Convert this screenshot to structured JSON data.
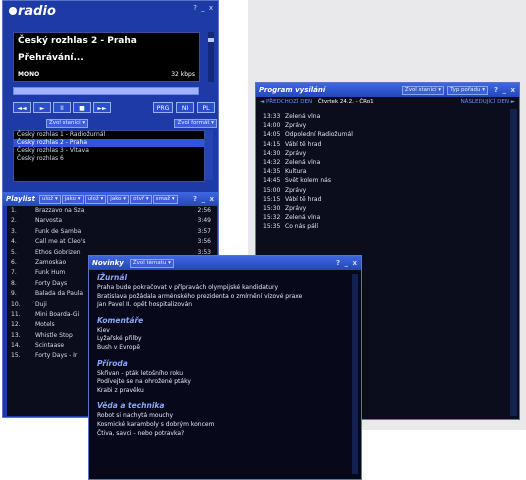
{
  "radio": {
    "logo": "radio",
    "controls": "? _ x",
    "station": "Český rozhlas 2 - Praha",
    "status": "Přehrávání...",
    "mode": "MONO",
    "bitrate": "32 kbps",
    "volume_progress": 1.0,
    "transport_buttons": [
      "◄◄",
      "►",
      "II",
      "■",
      "►►"
    ],
    "mode_buttons": [
      "PRG",
      "NI",
      "PL"
    ],
    "combo_stations": "Zvol stanici",
    "combo_format": "Zvol formát",
    "stations": [
      "Český rozhlas 1 - Radiožurnál",
      "Český rozhlas 2 - Praha",
      "Český rozhlas 3 - Vltava",
      "Český rozhlas 6"
    ],
    "selected_station_index": 1
  },
  "playlist": {
    "title": "Playlist",
    "actions": [
      "ulož",
      "jako",
      "ulož",
      "jako",
      "otvř",
      "smaž"
    ],
    "controls": "? _ x",
    "items": [
      {
        "n": "1.",
        "title": "Brazzavo na Sza",
        "dur": "2:56"
      },
      {
        "n": "2.",
        "title": "Narvosta",
        "dur": "3:49"
      },
      {
        "n": "3.",
        "title": "Funk de Samba",
        "dur": "3:57"
      },
      {
        "n": "4.",
        "title": "Call me at Cleo's",
        "dur": "3:56"
      },
      {
        "n": "5.",
        "title": "Ethos Gobrizen",
        "dur": "3:53"
      },
      {
        "n": "6.",
        "title": "Zamoskao",
        "dur": "2:59"
      },
      {
        "n": "7.",
        "title": "Funk Hum",
        "dur": ""
      },
      {
        "n": "8.",
        "title": "Forty Days",
        "dur": ""
      },
      {
        "n": "9.",
        "title": "Balada da Paula",
        "dur": ""
      },
      {
        "n": "10.",
        "title": "Duji",
        "dur": ""
      },
      {
        "n": "11.",
        "title": "Mini Boarda-Gi",
        "dur": ""
      },
      {
        "n": "12.",
        "title": "Motels",
        "dur": ""
      },
      {
        "n": "13.",
        "title": "Whistle Stop",
        "dur": ""
      },
      {
        "n": "14.",
        "title": "Scintaase",
        "dur": ""
      },
      {
        "n": "15.",
        "title": "Forty Days - Ir",
        "dur": ""
      }
    ]
  },
  "program": {
    "title": "Program vysílání",
    "combo_station": "Zvol stanici",
    "combo_type": "Typ pořadu",
    "controls": "? _ x",
    "prev": "◄ PŘEDCHOZÍ DEN",
    "day": "Čtvrtek 24.2. - ČRo1",
    "next": "NÁSLEDUJÍCÍ DEN ►",
    "rows": [
      {
        "time": "13:33",
        "name": "Zelená vlna"
      },
      {
        "time": "14:00",
        "name": "Zprávy"
      },
      {
        "time": "14:05",
        "name": "Odpolední Radiožurnál"
      },
      {
        "time": "14:15",
        "name": "Vábí tě hrad"
      },
      {
        "time": "14:30",
        "name": "Zprávy"
      },
      {
        "time": "14:32",
        "name": "Zelená vlna"
      },
      {
        "time": "14:35",
        "name": "Kultura"
      },
      {
        "time": "14:45",
        "name": "Svět kolem nás"
      },
      {
        "time": "15:00",
        "name": "Zprávy"
      },
      {
        "time": "15:15",
        "name": "Vábí tě hrad"
      },
      {
        "time": "15:30",
        "name": "Zprávy"
      },
      {
        "time": "15:32",
        "name": "Zelená vlna"
      },
      {
        "time": "15:35",
        "name": "Co nás pálí"
      }
    ]
  },
  "news": {
    "title": "Novinky",
    "combo_topic": "Zvol tématu",
    "controls": "? _ x",
    "sections": [
      {
        "heading": "iŽurnál",
        "items": [
          "Praha bude pokračovat v přípravách olympijské kandidatury",
          "Bratislava požádala arménského prezidenta o zmírnění vízové praxe",
          "Jan Pavel II. opět hospitalizován"
        ]
      },
      {
        "heading": "Komentáře",
        "items": [
          "Kiev",
          "Lyžařské přilby",
          "Bush v Evropě"
        ]
      },
      {
        "heading": "Příroda",
        "items": [
          "Skřivan - pták letošního roku",
          "Podívejte se na ohrožené ptáky",
          "Krabi z pravěku"
        ]
      },
      {
        "heading": "Věda a technika",
        "items": [
          "Robot si nachytá mouchy",
          "Kosmické karamboly s dobrým koncem",
          "Čtiva, savci - nebo potravka?"
        ]
      }
    ]
  },
  "colors": {
    "titlebar": "#2446b8",
    "panel": "#1e3aa6",
    "dark_bg": "#0b0d1c",
    "accent": "#6e8cff"
  }
}
